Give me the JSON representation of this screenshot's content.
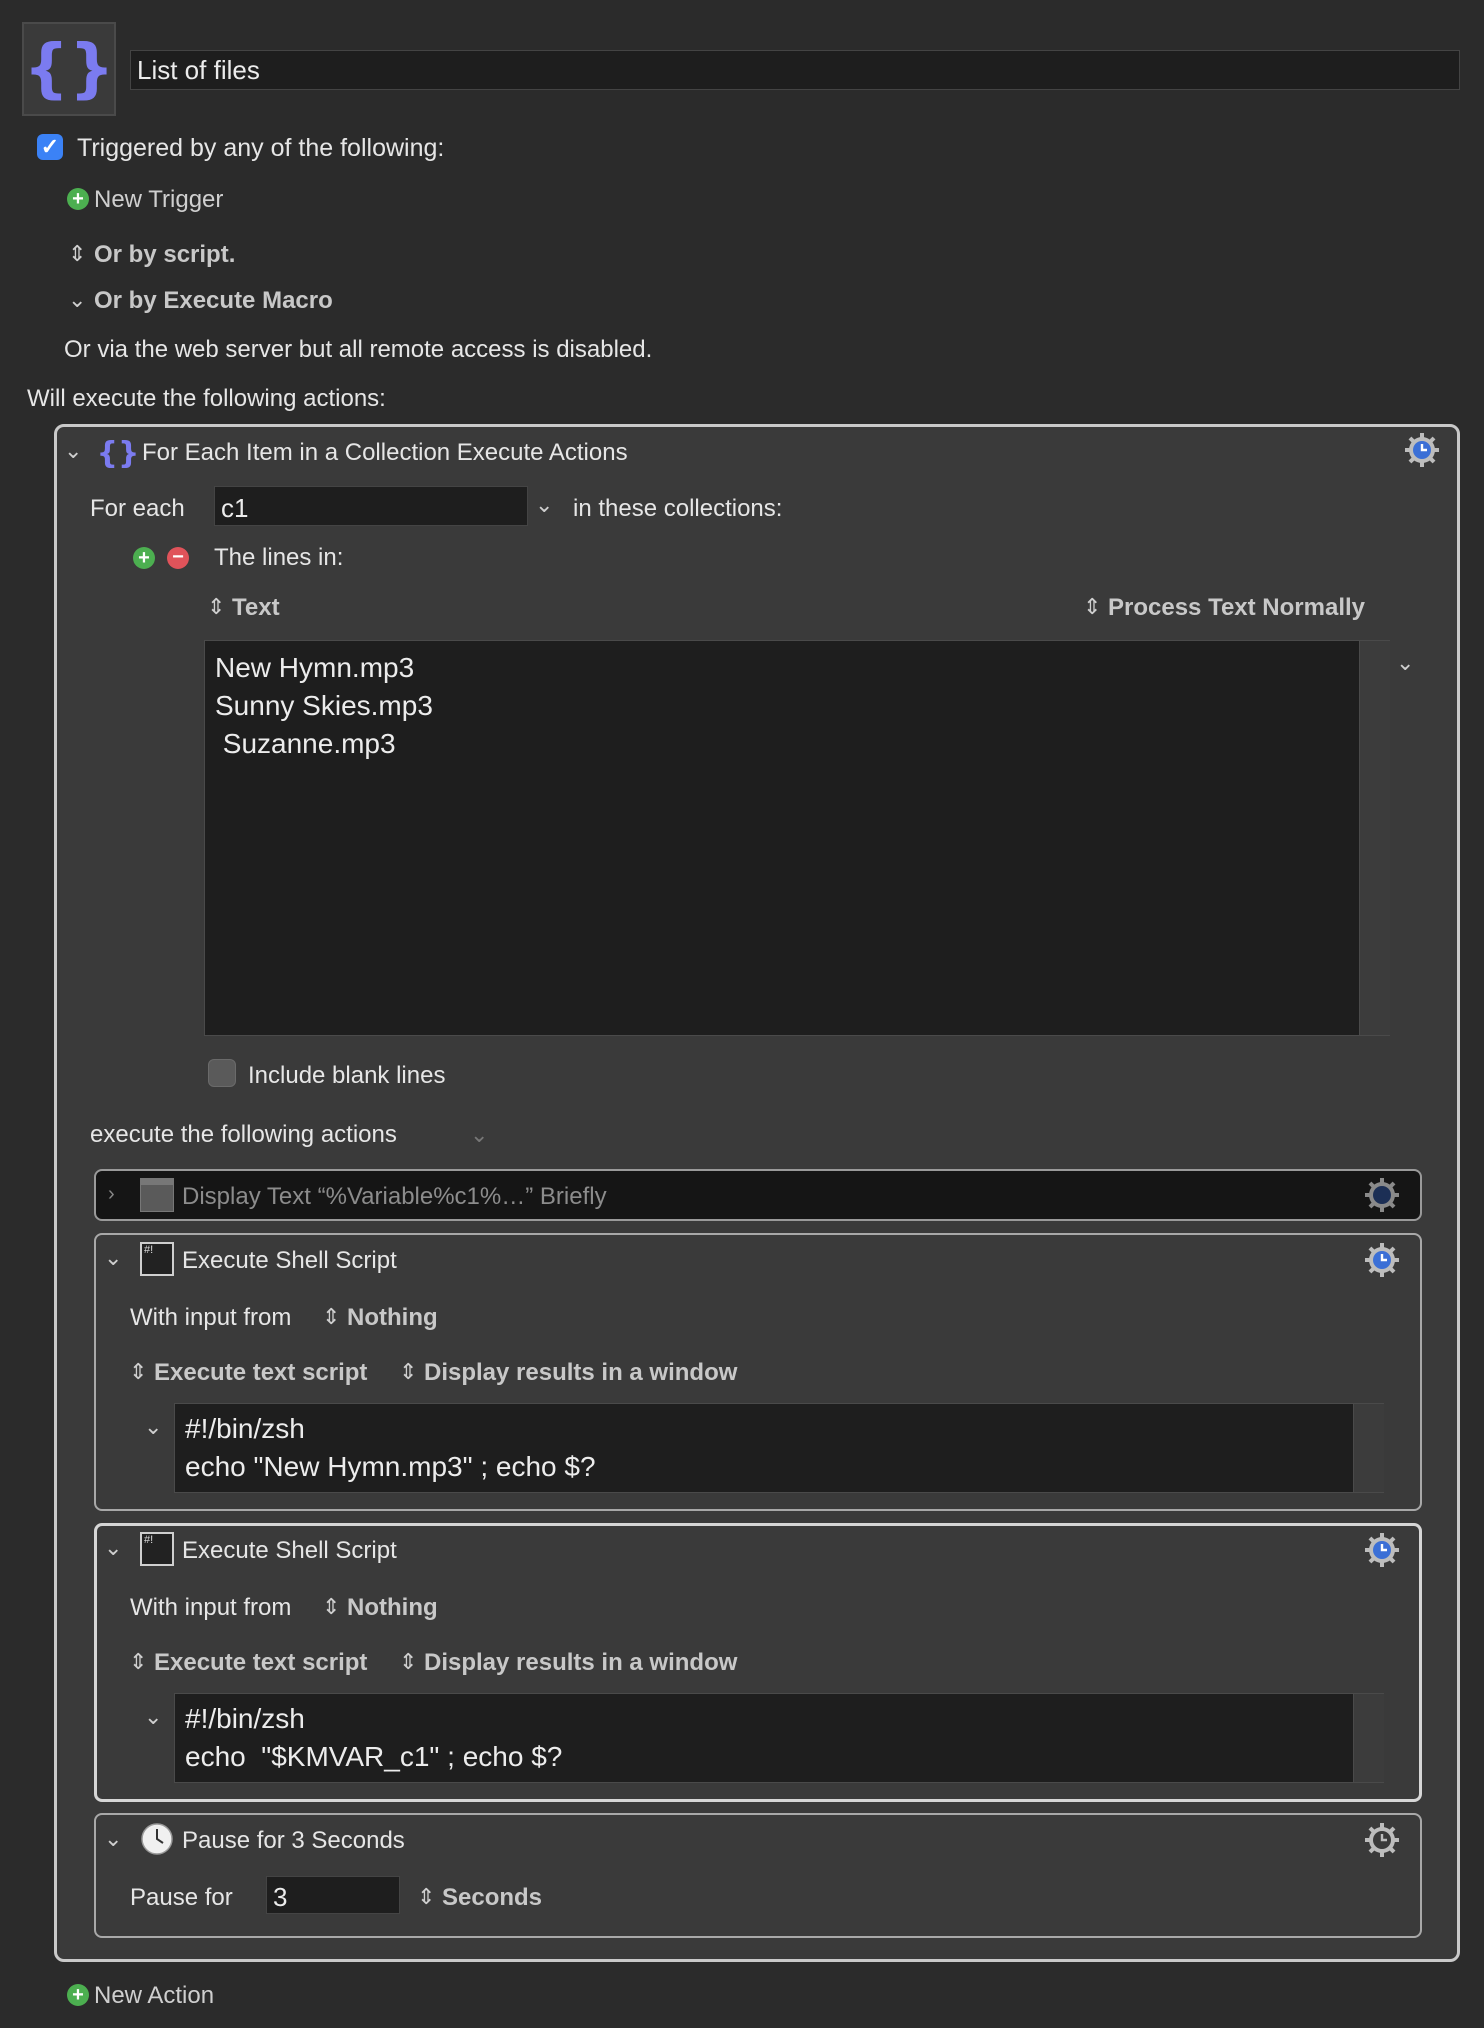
{
  "macro": {
    "name": "List of files",
    "trigger_label": "Triggered by any of the following:",
    "trigger_checked": true,
    "new_trigger": "New Trigger",
    "or_by_script": "Or by script.",
    "or_by_execute_macro": "Or by Execute Macro",
    "web_server_note": "Or via the web server but all remote access is disabled.",
    "will_execute": "Will execute the following actions:"
  },
  "for_each": {
    "title": "For Each Item in a Collection Execute Actions",
    "for_each_label": "For each",
    "variable": "c1",
    "in_collections": "in these collections:",
    "lines_in": "The lines in:",
    "text_source": "Text",
    "process_mode": "Process Text Normally",
    "lines_text": "New Hymn.mp3\nSunny Skies.mp3\n Suzanne.mp3",
    "include_blank": "Include blank lines",
    "include_blank_checked": false,
    "execute_following": "execute the following actions"
  },
  "actions": {
    "display_text": {
      "title": "Display Text “%Variable%c1%…” Briefly",
      "disabled": true
    },
    "shell1": {
      "title": "Execute Shell Script",
      "input_label": "With input from",
      "input_value": "Nothing",
      "source": "Execute text script",
      "output": "Display results in a window",
      "code": "#!/bin/zsh\necho \"New Hymn.mp3\" ; echo $?"
    },
    "shell2": {
      "title": "Execute Shell Script",
      "input_label": "With input from",
      "input_value": "Nothing",
      "source": "Execute text script",
      "output": "Display results in a window",
      "code": "#!/bin/zsh\necho  \"$KMVAR_c1\" ; echo $?"
    },
    "pause": {
      "title": "Pause for 3 Seconds",
      "label": "Pause for",
      "value": "3",
      "unit": "Seconds"
    }
  },
  "new_action": "New Action",
  "colors": {
    "background": "#2b2b2b",
    "checkbox_blue": "#3b82f6",
    "add_green": "#4caf50",
    "remove_red": "#e0535a",
    "icon_purple": "#7b7bf0",
    "gear_blue": "#3b6fd6"
  }
}
